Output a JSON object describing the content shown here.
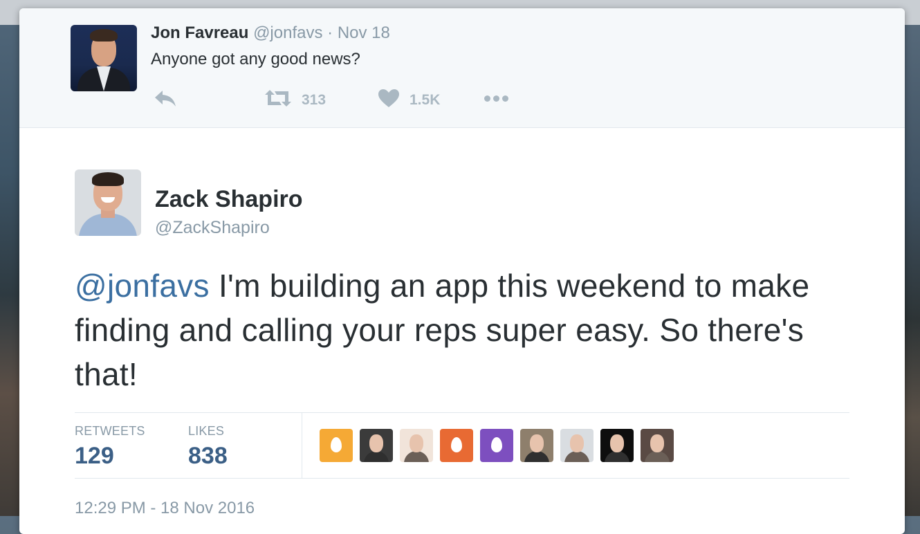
{
  "ancestor_tweet": {
    "name": "Jon Favreau",
    "handle": "@jonfavs",
    "separator": "·",
    "date": "Nov 18",
    "text": "Anyone got any good news?",
    "retweet_count": "313",
    "like_count": "1.5K",
    "icons": [
      "reply-icon",
      "retweet-icon",
      "heart-icon",
      "more-icon"
    ]
  },
  "main_tweet": {
    "name": "Zack Shapiro",
    "handle": "@ZackShapiro",
    "mention": "@jonfavs",
    "text": " I'm building an app this weekend to make finding and calling your reps super easy. So there's that!",
    "stats": {
      "retweets_label": "RETWEETS",
      "retweets_value": "129",
      "likes_label": "LIKES",
      "likes_value": "838"
    },
    "likers": [
      {
        "kind": "egg",
        "color": "#f5a935"
      },
      {
        "kind": "photo",
        "color": "#3b3b3b"
      },
      {
        "kind": "photo",
        "color": "#f1e4da"
      },
      {
        "kind": "egg",
        "color": "#e86a33"
      },
      {
        "kind": "egg",
        "color": "#7d4fbf"
      },
      {
        "kind": "photo",
        "color": "#8e7f6c"
      },
      {
        "kind": "photo",
        "color": "#d9dde1"
      },
      {
        "kind": "photo",
        "color": "#0e0e0e"
      },
      {
        "kind": "photo",
        "color": "#5a4a44"
      }
    ],
    "timestamp": "12:29 PM - 18 Nov 2016"
  },
  "colors": {
    "link_blue": "#3b6fa1",
    "count_blue": "#3b5f86",
    "muted": "#8899a6",
    "text": "#292f33"
  }
}
